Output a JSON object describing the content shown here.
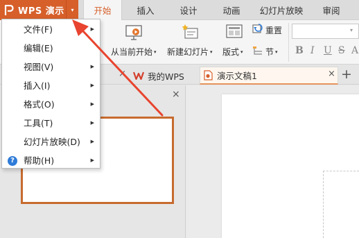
{
  "app": {
    "name": "WPS 演示",
    "caret": "▾"
  },
  "tabs": [
    "开始",
    "插入",
    "设计",
    "动画",
    "幻灯片放映",
    "审阅"
  ],
  "ribbon": {
    "from_current": "从当前开始",
    "new_slide": "新建幻灯片",
    "layout": "版式",
    "reset": "重置",
    "section": "节",
    "caret": "▾",
    "format_buttons": [
      "B",
      "I",
      "U",
      "S",
      "A"
    ]
  },
  "doc_tabs": {
    "home": "我的WPS",
    "document": "演示文稿1",
    "close": "×",
    "add": "+"
  },
  "pane_close": "×",
  "menu": {
    "items": [
      {
        "label": "文件(F)"
      },
      {
        "label": "编辑(E)"
      },
      {
        "label": "视图(V)"
      },
      {
        "label": "插入(I)"
      },
      {
        "label": "格式(O)"
      },
      {
        "label": "工具(T)"
      },
      {
        "label": "幻灯片放映(D)"
      },
      {
        "label": "帮助(H)",
        "icon": "help-icon"
      }
    ],
    "help_glyph": "?"
  },
  "annotation": {
    "arrow_color": "#e8442f"
  }
}
